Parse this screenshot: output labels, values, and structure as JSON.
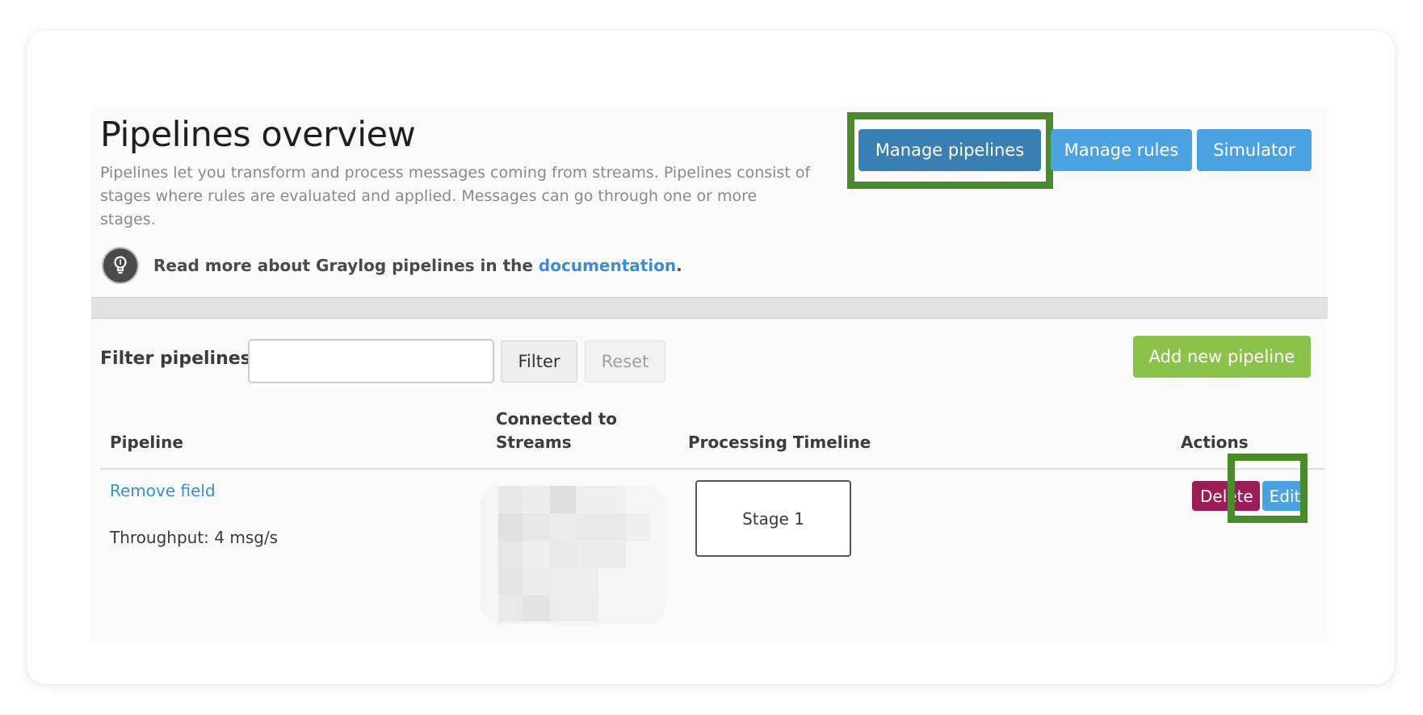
{
  "header": {
    "title": "Pipelines overview",
    "description": "Pipelines let you transform and process messages coming from streams. Pipelines consist of stages where rules are evaluated and applied. Messages can go through one or more stages.",
    "tip_prefix": "Read more about Graylog pipelines in the ",
    "tip_link": "documentation",
    "tip_suffix": "."
  },
  "nav_buttons": {
    "manage_pipelines": "Manage pipelines",
    "manage_rules": "Manage rules",
    "simulator": "Simulator"
  },
  "filter": {
    "label": "Filter pipelines",
    "value": "",
    "filter_button": "Filter",
    "reset_button": "Reset",
    "add_button": "Add new pipeline"
  },
  "table": {
    "headers": {
      "pipeline": "Pipeline",
      "streams_line1": "Connected to",
      "streams_line2": "Streams",
      "timeline": "Processing Timeline",
      "actions": "Actions"
    },
    "rows": [
      {
        "name": "Remove field",
        "throughput": "Throughput: 4 msg/s",
        "stage": "Stage 1",
        "delete_label": "Delete",
        "edit_label": "Edit"
      }
    ]
  },
  "colors": {
    "primary": "#4aa3e0",
    "primary_active": "#3a7fb3",
    "success": "#8bc34a",
    "danger": "#9b1c57",
    "highlight": "#4a8a2c",
    "link": "#3a8fd0"
  },
  "icons": {
    "tip": "lightbulb-icon"
  }
}
